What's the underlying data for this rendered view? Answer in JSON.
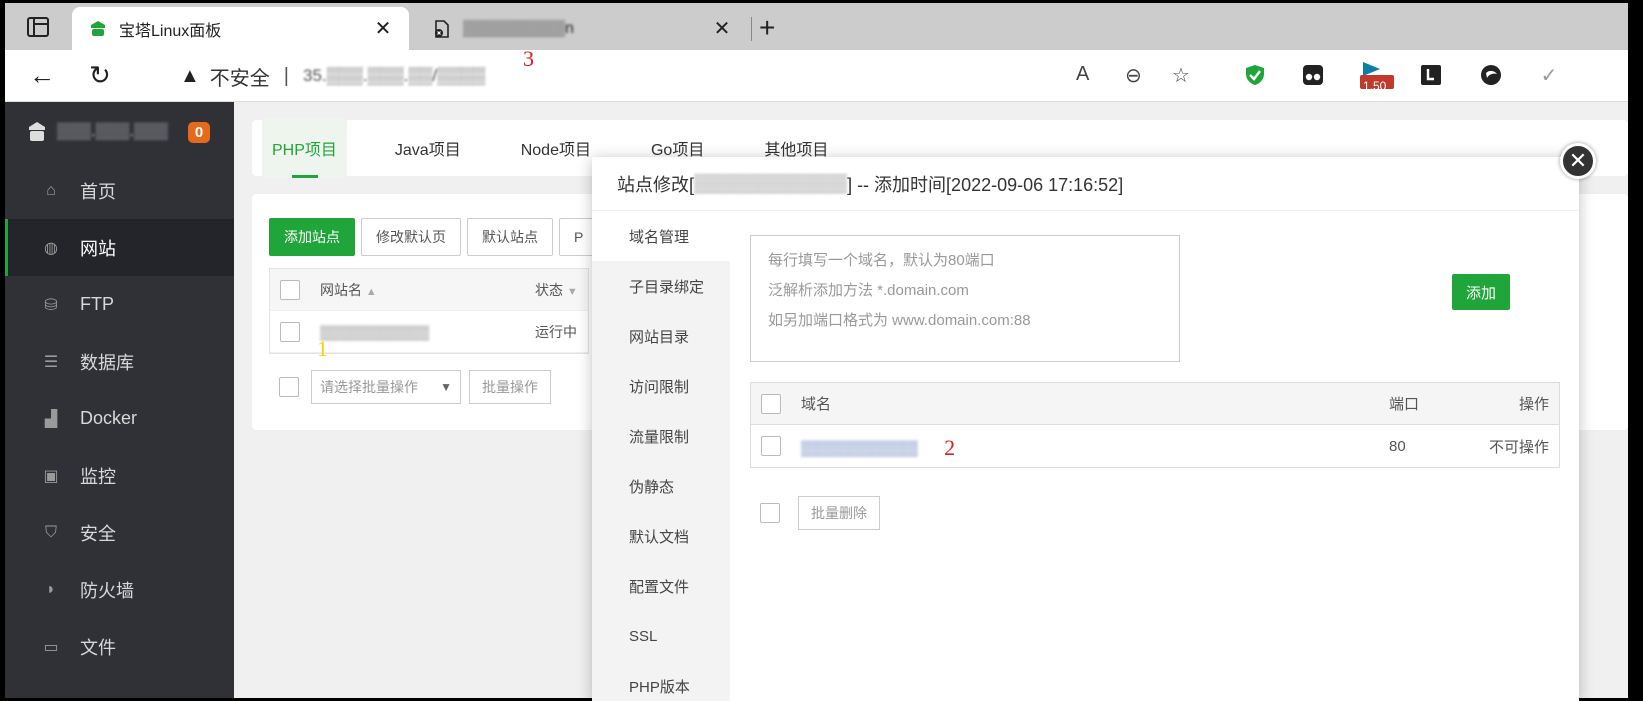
{
  "browser": {
    "tabs": [
      {
        "title": "宝塔Linux面板",
        "active": true
      },
      {
        "title": "▒▒▒▒▒▒▒▒▒n",
        "active": false
      }
    ],
    "address": {
      "insecure_label": "不安全",
      "separator": "|",
      "url": "35.▒▒▒.▒▒▒.▒▒/▒▒▒▒"
    },
    "extension_badge": "1.50"
  },
  "annotations": {
    "one": "1",
    "two": "2",
    "three": "3"
  },
  "sidebar": {
    "host": "▒▒▒.▒▒▒.▒▒▒",
    "badge": "0",
    "items": [
      {
        "label": "首页",
        "icon": "home-icon"
      },
      {
        "label": "网站",
        "icon": "globe-icon"
      },
      {
        "label": "FTP",
        "icon": "ftp-icon"
      },
      {
        "label": "数据库",
        "icon": "database-icon"
      },
      {
        "label": "Docker",
        "icon": "docker-icon"
      },
      {
        "label": "监控",
        "icon": "monitor-icon"
      },
      {
        "label": "安全",
        "icon": "shield-icon"
      },
      {
        "label": "防火墙",
        "icon": "firewall-icon"
      },
      {
        "label": "文件",
        "icon": "folder-icon"
      }
    ]
  },
  "project_tabs": [
    "PHP项目",
    "Java项目",
    "Node项目",
    "Go项目",
    "其他项目"
  ],
  "site_list": {
    "buttons": [
      "添加站点",
      "修改默认页",
      "默认站点",
      "P"
    ],
    "columns": [
      "网站名",
      "状态"
    ],
    "rows": [
      {
        "name": "▒▒▒▒▒▒▒▒▒▒▒",
        "status": "运行中"
      }
    ],
    "batch_placeholder": "请选择批量操作",
    "batch_button": "批量操作"
  },
  "modal": {
    "title_prefix": "站点修改[",
    "title_site": "▒▒▒▒▒▒▒▒▒▒▒▒",
    "title_suffix": "] -- 添加时间[2022-09-06 17:16:52]",
    "menu": [
      "域名管理",
      "子目录绑定",
      "网站目录",
      "访问限制",
      "流量限制",
      "伪静态",
      "默认文档",
      "配置文件",
      "SSL",
      "PHP版本"
    ],
    "textarea_lines": [
      "每行填写一个域名，默认为80端口",
      "泛解析添加方法 *.domain.com",
      "如另加端口格式为 www.domain.com:88"
    ],
    "add_button": "添加",
    "table_headers": {
      "domain": "域名",
      "port": "端口",
      "action": "操作"
    },
    "rows": [
      {
        "domain": "▒▒▒▒▒▒▒▒▒▒▒",
        "port": "80",
        "action": "不可操作"
      }
    ],
    "batch_delete": "批量删除"
  }
}
